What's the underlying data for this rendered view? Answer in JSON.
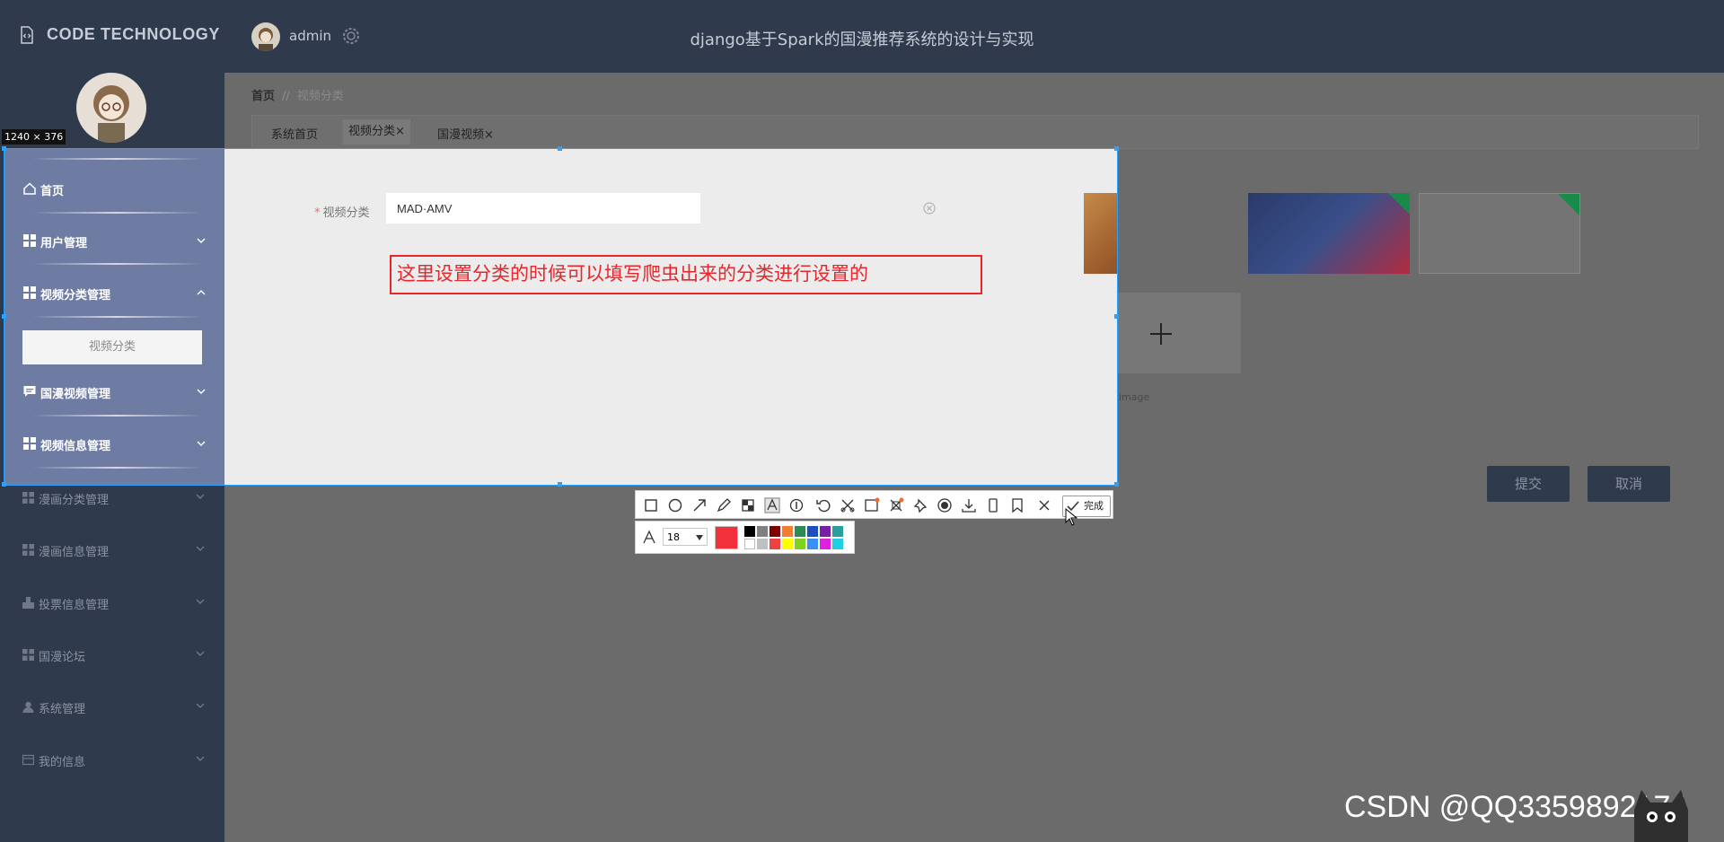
{
  "app": {
    "logo_text": "CODE TECHNOLOGY",
    "user_name": "admin",
    "system_title": "django基于Spark的国漫推荐系统的设计与实现"
  },
  "breadcrumb": {
    "home": "首页",
    "separator": "//",
    "current": "视频分类"
  },
  "tabs": [
    {
      "label": "系统首页"
    },
    {
      "label": "视频分类",
      "close": "×"
    },
    {
      "label": "国漫视频",
      "close": "×"
    }
  ],
  "sidebar": {
    "items": [
      {
        "label": "首页",
        "icon": "home-icon"
      },
      {
        "label": "用户管理",
        "icon": "grid-icon"
      },
      {
        "label": "视频分类管理",
        "icon": "grid-icon",
        "expanded": true
      },
      {
        "label": "视频分类",
        "icon": ""
      },
      {
        "label": "国漫视频管理",
        "icon": "chat-icon"
      },
      {
        "label": "视频信息管理",
        "icon": "grid-icon"
      },
      {
        "label": "漫画分类管理",
        "icon": "grid-icon"
      },
      {
        "label": "漫画信息管理",
        "icon": "grid-icon"
      },
      {
        "label": "投票信息管理",
        "icon": "vote-icon"
      },
      {
        "label": "国漫论坛",
        "icon": "grid-icon"
      },
      {
        "label": "系统管理",
        "icon": "user-icon"
      },
      {
        "label": "我的信息",
        "icon": "card-icon"
      }
    ]
  },
  "form": {
    "required_mark": "*",
    "category_label": "视频分类",
    "category_value": "MAD·AMV",
    "image_label": "image",
    "upload_hint": "点击上传image",
    "submit_label": "提交",
    "cancel_label": "取消"
  },
  "screenshot_tool": {
    "size_badge": "1240 × 376",
    "annotation_text": "这里设置分类的时候可以填写爬虫出来的分类进行设置的",
    "done_label": "完成",
    "font_size": "18",
    "current_color": "#f3313a",
    "palette": [
      "#000000",
      "#808080",
      "#800000",
      "#f08030",
      "#2e8b57",
      "#1f4fbf",
      "#7a1fa2",
      "#2a9d9d",
      "#ffffff",
      "#c0c0c0",
      "#f04040",
      "#ffff00",
      "#7fd320",
      "#3a8ff5",
      "#e020e0",
      "#20d0e0"
    ]
  },
  "watermark": "CSDN @QQ3359892174",
  "colors": {
    "header_bg": "#2f3a4d",
    "selection_border": "#2aa3ff",
    "annotation_red": "#e8262b"
  }
}
